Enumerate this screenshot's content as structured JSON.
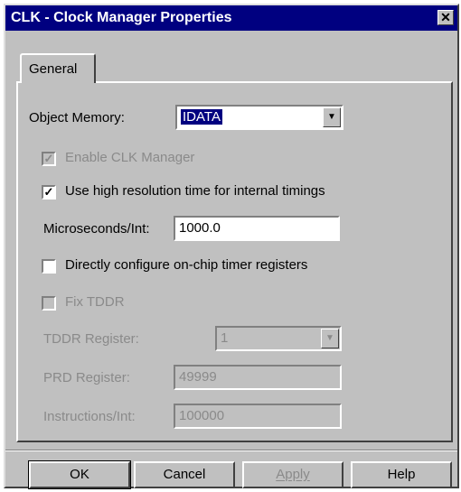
{
  "window": {
    "title": "CLK - Clock Manager Properties",
    "close_label": "✕"
  },
  "tabs": [
    {
      "label": "General"
    }
  ],
  "form": {
    "object_memory": {
      "label": "Object Memory:",
      "value": "IDATA"
    },
    "enable_clk_manager": {
      "label": "Enable CLK Manager",
      "checked": true,
      "enabled": false,
      "mark": "✓"
    },
    "use_high_res": {
      "label": "Use high resolution time for internal timings",
      "checked": true,
      "enabled": true,
      "mark": "✓"
    },
    "microseconds_int": {
      "label": "Microseconds/Int:",
      "value": "1000.0"
    },
    "directly_configure": {
      "label": "Directly configure on-chip timer registers",
      "checked": false,
      "enabled": true
    },
    "fix_tddr": {
      "label": "Fix TDDR",
      "checked": false,
      "enabled": false
    },
    "tddr_register": {
      "label": "TDDR Register:",
      "value": "1"
    },
    "prd_register": {
      "label": "PRD Register:",
      "value": "49999"
    },
    "instructions_int": {
      "label": "Instructions/Int:",
      "value": "100000"
    }
  },
  "buttons": {
    "ok": "OK",
    "cancel": "Cancel",
    "apply": "Apply",
    "help": "Help"
  },
  "icons": {
    "dropdown_arrow": "▼"
  }
}
